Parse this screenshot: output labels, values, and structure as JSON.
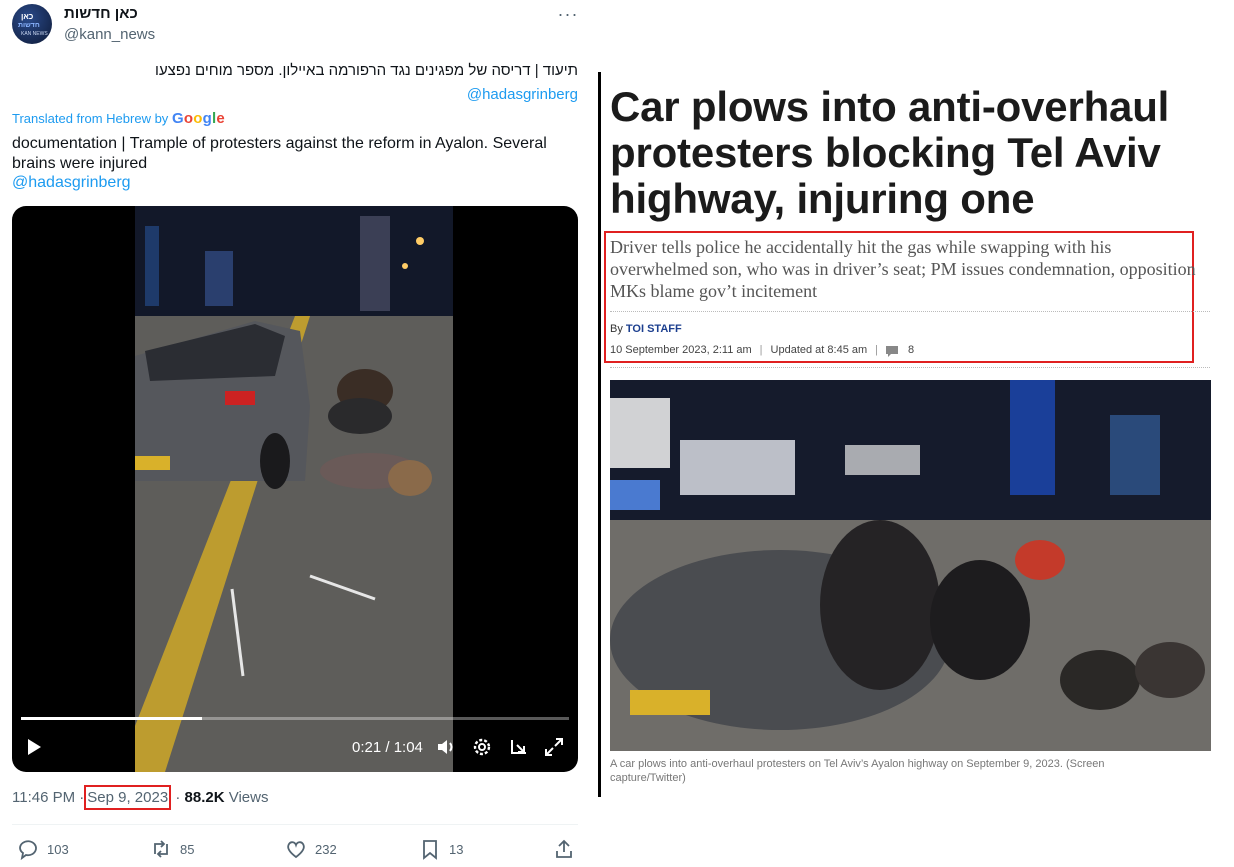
{
  "tweet": {
    "display_name": "כאן חדשות",
    "handle": "@kann_news",
    "avatar": {
      "line1": "כאן",
      "line2": "חדשות",
      "line3": "KAN NEWS"
    },
    "more_label": "···",
    "hebrew_text": "תיעוד | דריסה של מפגינים נגד הרפורמה באיילון. מספר מוחים נפצעו",
    "mention": "@hadasgrinberg",
    "translated_label": "Translated from Hebrew by",
    "translated_brand": {
      "g1": "G",
      "o1": "o",
      "o2": "o",
      "g2": "g",
      "l": "l",
      "e": "e"
    },
    "english_text": "documentation | Trample of protesters against the reform in Ayalon. Several brains were injured",
    "video": {
      "time": "0:21 / 1:04",
      "progress": 0.33
    },
    "time": "11:46 PM",
    "separator": "·",
    "date": "Sep 9, 2023",
    "views_count": "88.2K",
    "views_label": "Views",
    "actions": {
      "replies": "103",
      "reposts": "85",
      "likes": "232",
      "bookmarks": "13"
    }
  },
  "article": {
    "headline": "Car plows into anti-overhaul protesters blocking Tel Aviv highway, injuring one",
    "subhead": "Driver tells police he accidentally hit the gas while swapping with his overwhelmed son, who was in driver’s seat; PM issues condemnation, opposition MKs blame gov’t incitement",
    "byline_prefix": "By",
    "author": "TOI STAFF",
    "published": "10 September 2023, 2:11 am",
    "divider": "|",
    "updated": "Updated at 8:45 am",
    "comments": "8",
    "caption": "A car plows into anti-overhaul protesters on Tel Aviv’s Ayalon highway on September 9, 2023. (Screen capture/Twitter)"
  },
  "colors": {
    "link_blue": "#1d9bf0",
    "highlight_red": "#e02020",
    "author_blue": "#1c3f8f"
  }
}
